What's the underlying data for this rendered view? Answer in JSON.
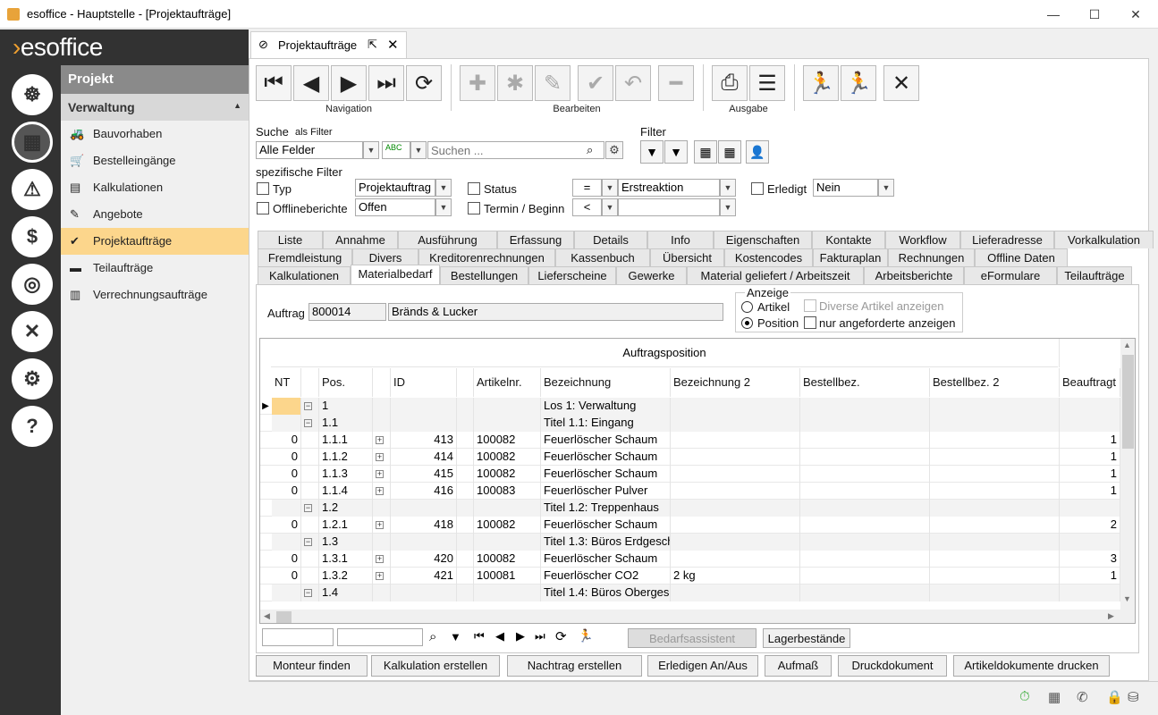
{
  "window": {
    "title": "esoffice - Hauptstelle - [Projektaufträge]"
  },
  "logo": "esoffice",
  "nav": {
    "header": "Projekt",
    "group": "Verwaltung",
    "items": [
      {
        "label": "Bauvorhaben",
        "icon": "bulldozer-icon"
      },
      {
        "label": "Bestelleingänge",
        "icon": "cart-icon"
      },
      {
        "label": "Kalkulationen",
        "icon": "calculator-document-icon"
      },
      {
        "label": "Angebote",
        "icon": "offer-icon"
      },
      {
        "label": "Projektaufträge",
        "icon": "checkmark-circle-icon",
        "selected": true
      },
      {
        "label": "Teilaufträge",
        "icon": "stack-icon"
      },
      {
        "label": "Verrechnungsaufträge",
        "icon": "billing-icon"
      }
    ]
  },
  "doc_tab": {
    "label": "Projektaufträge"
  },
  "toolbar": {
    "groups": {
      "navigation": "Navigation",
      "edit": "Bearbeiten",
      "output": "Ausgabe"
    }
  },
  "search": {
    "label": "Suche",
    "as_filter": "als Filter",
    "field": "Alle Felder",
    "placeholder": "Suchen ...",
    "filter_label": "Filter",
    "specific_label": "spezifische Filter"
  },
  "filters": {
    "typ_label": "Typ",
    "typ_value": "Projektauftrag",
    "offline_label": "Offlineberichte",
    "offline_value": "Offen",
    "status_label": "Status",
    "status_op": "=",
    "status_value": "Erstreaktion",
    "termin_label": "Termin / Beginn",
    "termin_op": "<",
    "termin_value": "",
    "erledigt_label": "Erledigt",
    "erledigt_value": "Nein"
  },
  "tabs_row1": [
    "Liste",
    "Annahme",
    "Ausführung",
    "Erfassung",
    "Details",
    "Info",
    "Eigenschaften",
    "Kontakte",
    "Workflow",
    "Lieferadresse",
    "Vorkalkulation"
  ],
  "tabs_row2": [
    "Fremdleistung",
    "Divers",
    "Kreditorenrechnungen",
    "Kassenbuch",
    "Übersicht",
    "Kostencodes",
    "Fakturaplan",
    "Rechnungen",
    "Offline Daten"
  ],
  "tabs_row3": [
    "Kalkulationen",
    "Materialbedarf",
    "Bestellungen",
    "Lieferscheine",
    "Gewerke",
    "Material geliefert / Arbeitszeit",
    "Arbeitsberichte",
    "eFormulare",
    "Teilaufträge"
  ],
  "auftrag": {
    "label": "Auftrag",
    "number": "800014",
    "name": "Bränds & Lucker"
  },
  "anzeige": {
    "title": "Anzeige",
    "artikel": "Artikel",
    "position": "Position",
    "diverse": "Diverse Artikel anzeigen",
    "angefordert": "nur angeforderte anzeigen"
  },
  "grid": {
    "group_header": "Auftragsposition",
    "columns": [
      "NT",
      "",
      "Pos.",
      "",
      "ID",
      "",
      "Artikelnr.",
      "Bezeichnung",
      "Bezeichnung 2",
      "Bestellbez.",
      "Bestellbez. 2",
      "Beauftragt"
    ],
    "rows": [
      {
        "nt": "",
        "exp": "⊟",
        "pos": "1",
        "exp2": "",
        "id": "",
        "art": "",
        "bez": "Los 1: Verwaltung",
        "bez2": "",
        "beauf": "",
        "current": true
      },
      {
        "nt": "",
        "exp": "⊟",
        "pos": "1.1",
        "exp2": "",
        "id": "",
        "art": "",
        "bez": "Titel 1.1: Eingang",
        "bez2": "",
        "beauf": ""
      },
      {
        "nt": "0",
        "exp": "",
        "pos": "1.1.1",
        "exp2": "⊞",
        "id": "413",
        "art": "100082",
        "bez": "Feuerlöscher Schaum",
        "bez2": "",
        "beauf": "1"
      },
      {
        "nt": "0",
        "exp": "",
        "pos": "1.1.2",
        "exp2": "⊞",
        "id": "414",
        "art": "100082",
        "bez": "Feuerlöscher Schaum",
        "bez2": "",
        "beauf": "1"
      },
      {
        "nt": "0",
        "exp": "",
        "pos": "1.1.3",
        "exp2": "⊞",
        "id": "415",
        "art": "100082",
        "bez": "Feuerlöscher Schaum",
        "bez2": "",
        "beauf": "1"
      },
      {
        "nt": "0",
        "exp": "",
        "pos": "1.1.4",
        "exp2": "⊞",
        "id": "416",
        "art": "100083",
        "bez": "Feuerlöscher Pulver",
        "bez2": "",
        "beauf": "1"
      },
      {
        "nt": "",
        "exp": "⊟",
        "pos": "1.2",
        "exp2": "",
        "id": "",
        "art": "",
        "bez": "Titel 1.2: Treppenhaus",
        "bez2": "",
        "beauf": ""
      },
      {
        "nt": "0",
        "exp": "",
        "pos": "1.2.1",
        "exp2": "⊞",
        "id": "418",
        "art": "100082",
        "bez": "Feuerlöscher Schaum",
        "bez2": "",
        "beauf": "2"
      },
      {
        "nt": "",
        "exp": "⊟",
        "pos": "1.3",
        "exp2": "",
        "id": "",
        "art": "",
        "bez": "Titel 1.3: Büros Erdgesch",
        "bez2": "",
        "beauf": ""
      },
      {
        "nt": "0",
        "exp": "",
        "pos": "1.3.1",
        "exp2": "⊞",
        "id": "420",
        "art": "100082",
        "bez": "Feuerlöscher Schaum",
        "bez2": "",
        "beauf": "3"
      },
      {
        "nt": "0",
        "exp": "",
        "pos": "1.3.2",
        "exp2": "⊞",
        "id": "421",
        "art": "100081",
        "bez": "Feuerlöscher CO2",
        "bez2": "2 kg",
        "beauf": "1"
      },
      {
        "nt": "",
        "exp": "⊟",
        "pos": "1.4",
        "exp2": "",
        "id": "",
        "art": "",
        "bez": "Titel 1.4: Büros Obergesc",
        "bez2": "",
        "beauf": ""
      }
    ]
  },
  "grid_footer": {
    "bedarf": "Bedarfsassistent",
    "lager": "Lagerbestände"
  },
  "bottom_buttons": [
    "Monteur finden",
    "Kalkulation erstellen",
    "Nachtrag erstellen",
    "Erledigen An/Aus",
    "Aufmaß",
    "Druckdokument",
    "Artikeldokumente drucken"
  ]
}
